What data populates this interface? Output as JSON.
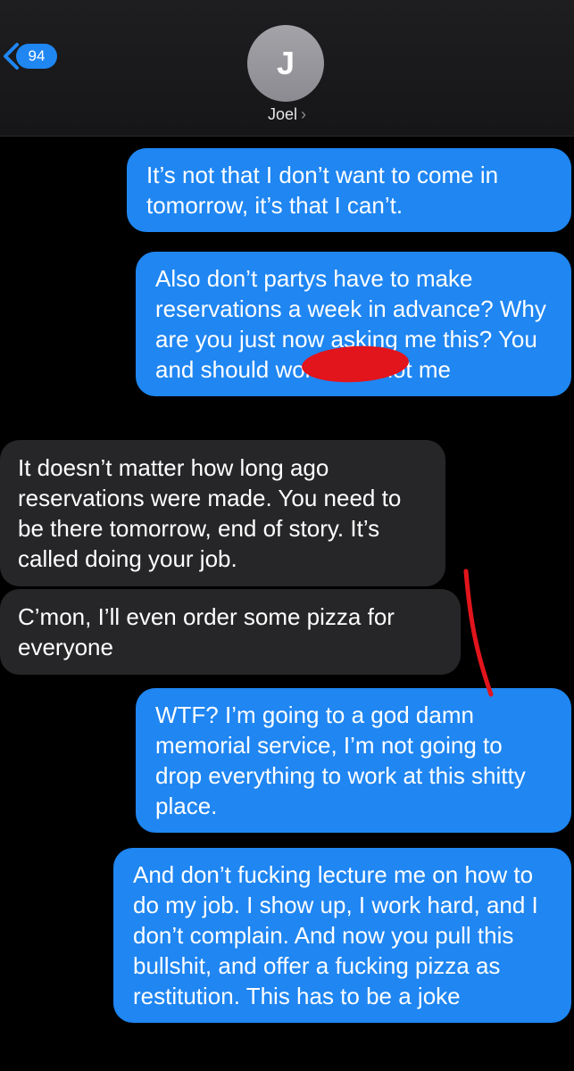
{
  "header": {
    "back_count": "94",
    "avatar_initial": "J",
    "contact_name": "Joel",
    "contact_chevron": "›"
  },
  "icons": {
    "back": "chevron-left-icon",
    "contact": "chevron-right-icon"
  },
  "colors": {
    "sent_bubble": "#1f86f2",
    "received_bubble": "#262628",
    "background": "#000000",
    "annotation": "#e2141c"
  },
  "messages": [
    {
      "from": "me",
      "text": "It’s not that I don’t want to come in tomorrow, it’s that I can’t."
    },
    {
      "from": "me",
      "text": "Also don’t partys have to make reservations a week in advance? Why are you just now asking me this? You and                    should work this, not me"
    },
    {
      "from": "them",
      "text": "It doesn’t matter how long ago reservations were made. You need to be there tomorrow, end of story. It’s called doing your job."
    },
    {
      "from": "them",
      "text": "C’mon, I’ll even order some pizza for everyone"
    },
    {
      "from": "me",
      "text": "WTF? I’m going to a god damn memorial service, I’m not going to drop everything to work at this shitty place."
    },
    {
      "from": "me",
      "text": "And don’t fucking lecture me on how to do my job. I show up, I work hard, and I don’t complain. And now you pull this bullshit, and offer a fucking pizza as restitution. This has to be a joke"
    }
  ]
}
